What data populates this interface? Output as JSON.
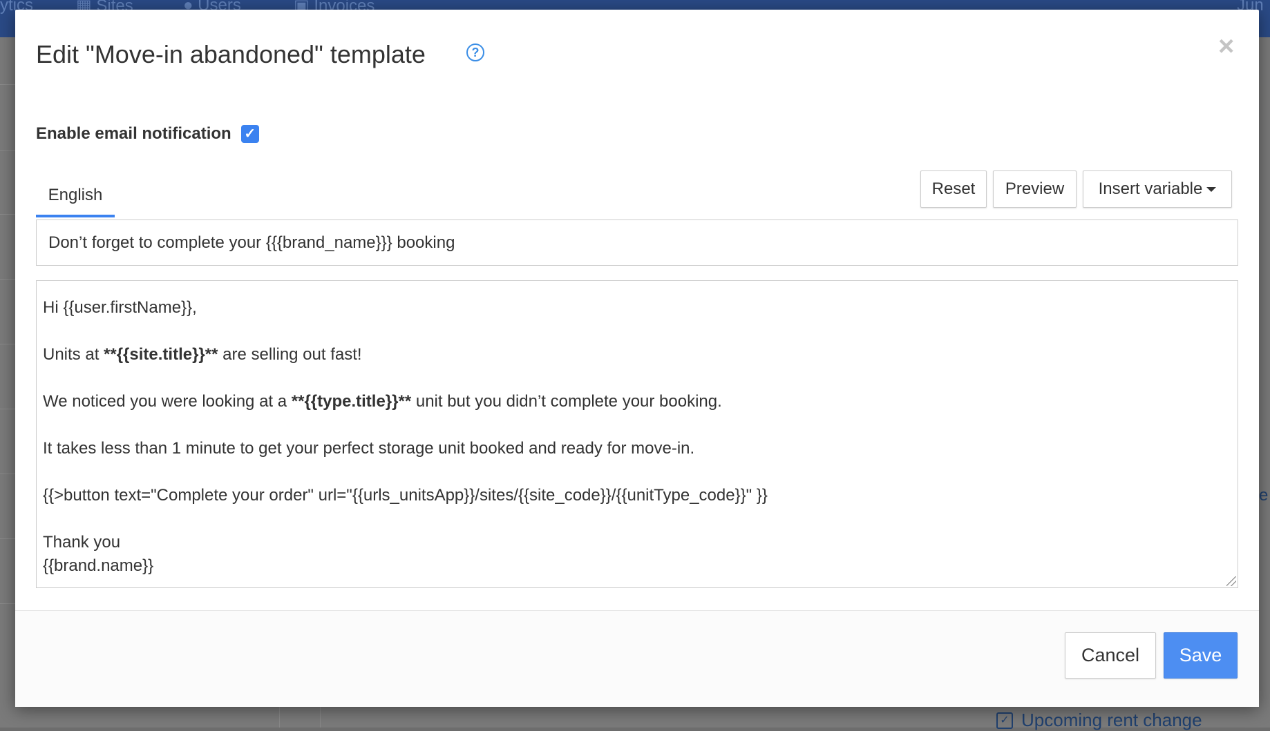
{
  "background": {
    "nav": [
      {
        "label": "ytics"
      },
      {
        "label": "Sites"
      },
      {
        "label": "Users"
      },
      {
        "label": "Invoices"
      }
    ],
    "date_fragment": "Jun",
    "upcoming_label": "Upcoming rent change",
    "right_fragment": "e"
  },
  "modal": {
    "title": "Edit \"Move-in abandoned\" template",
    "help_icon": "question-circle-icon",
    "close_icon": "close-icon",
    "enable_label": "Enable email notification",
    "enable_checked": true,
    "tabs": [
      {
        "label": "English",
        "active": true
      }
    ],
    "buttons": {
      "reset": "Reset",
      "preview": "Preview",
      "insert_variable": "Insert variable"
    },
    "subject": "Don’t forget to complete your {{{brand_name}}} booking",
    "body": {
      "greeting": "Hi {{user.firstName}},",
      "units_prefix": "Units at ",
      "units_bold": "**{{site.title}}**",
      "units_suffix": " are selling out fast!",
      "noticed_prefix": "We noticed you were looking at a ",
      "noticed_bold": "**{{type.title}}**",
      "noticed_suffix": " unit but you didn’t complete your booking.",
      "takes": "It takes less than 1 minute to get your perfect storage unit booked and ready for move-in.",
      "button_line": "{{>button text=\"Complete your order\" url=\"{{urls_unitsApp}}/sites/{{site_code}}/{{unitType_code}}\" }}",
      "thanks": "Thank you",
      "signature": "{{brand.name}}"
    },
    "footer": {
      "cancel": "Cancel",
      "save": "Save"
    },
    "colors": {
      "accent": "#3b82f0",
      "save_bg": "#4d8ef2",
      "help": "#3b8ee6"
    }
  }
}
